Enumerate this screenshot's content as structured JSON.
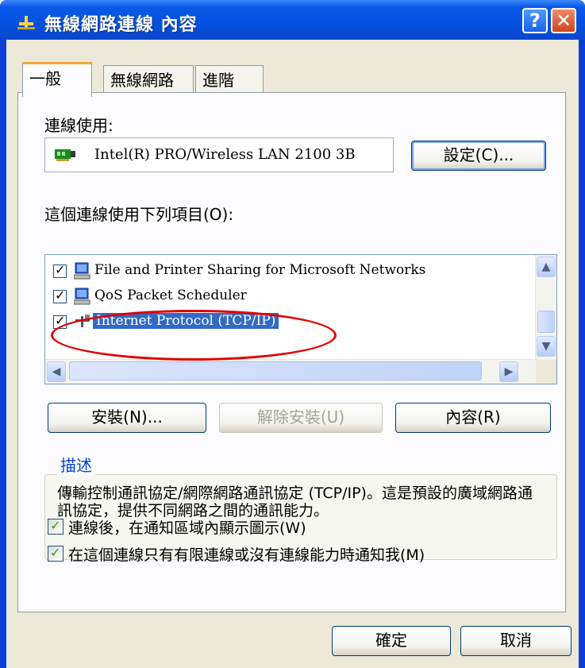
{
  "window": {
    "title": "無線網路連線 內容",
    "help_label": "?",
    "close_label": "✕"
  },
  "tabs": [
    {
      "label": "一般"
    },
    {
      "label": "無線網路"
    },
    {
      "label": "進階"
    }
  ],
  "connect_using": {
    "label": "連線使用:",
    "device": "Intel(R) PRO/Wireless LAN 2100 3B",
    "configure_label": "設定(C)..."
  },
  "items": {
    "label": "這個連線使用下列項目(O):",
    "rows": [
      {
        "text": "File and Printer Sharing for Microsoft Networks",
        "checked": true
      },
      {
        "text": "QoS Packet Scheduler",
        "checked": true
      },
      {
        "text": "Internet Protocol (TCP/IP)",
        "checked": true,
        "selected": true
      }
    ]
  },
  "buttons": {
    "install": "安裝(N)...",
    "uninstall": "解除安裝(U)",
    "properties": "內容(R)"
  },
  "description": {
    "title": "描述",
    "text": "傳輸控制通訊協定/網際網路通訊協定 (TCP/IP)。這是預設的廣域網路通訊協定，提供不同網路之間的通訊能力。"
  },
  "options": {
    "show_icon": "連線後，在通知區域內顯示圖示(W)",
    "notify": "在這個連線只有有限連線或沒有連線能力時通知我(M)"
  },
  "footer": {
    "ok": "確定",
    "cancel": "取消"
  },
  "colors": {
    "titlebar": "#0451e0",
    "selection": "#316ac5",
    "annotation": "#e00000"
  }
}
